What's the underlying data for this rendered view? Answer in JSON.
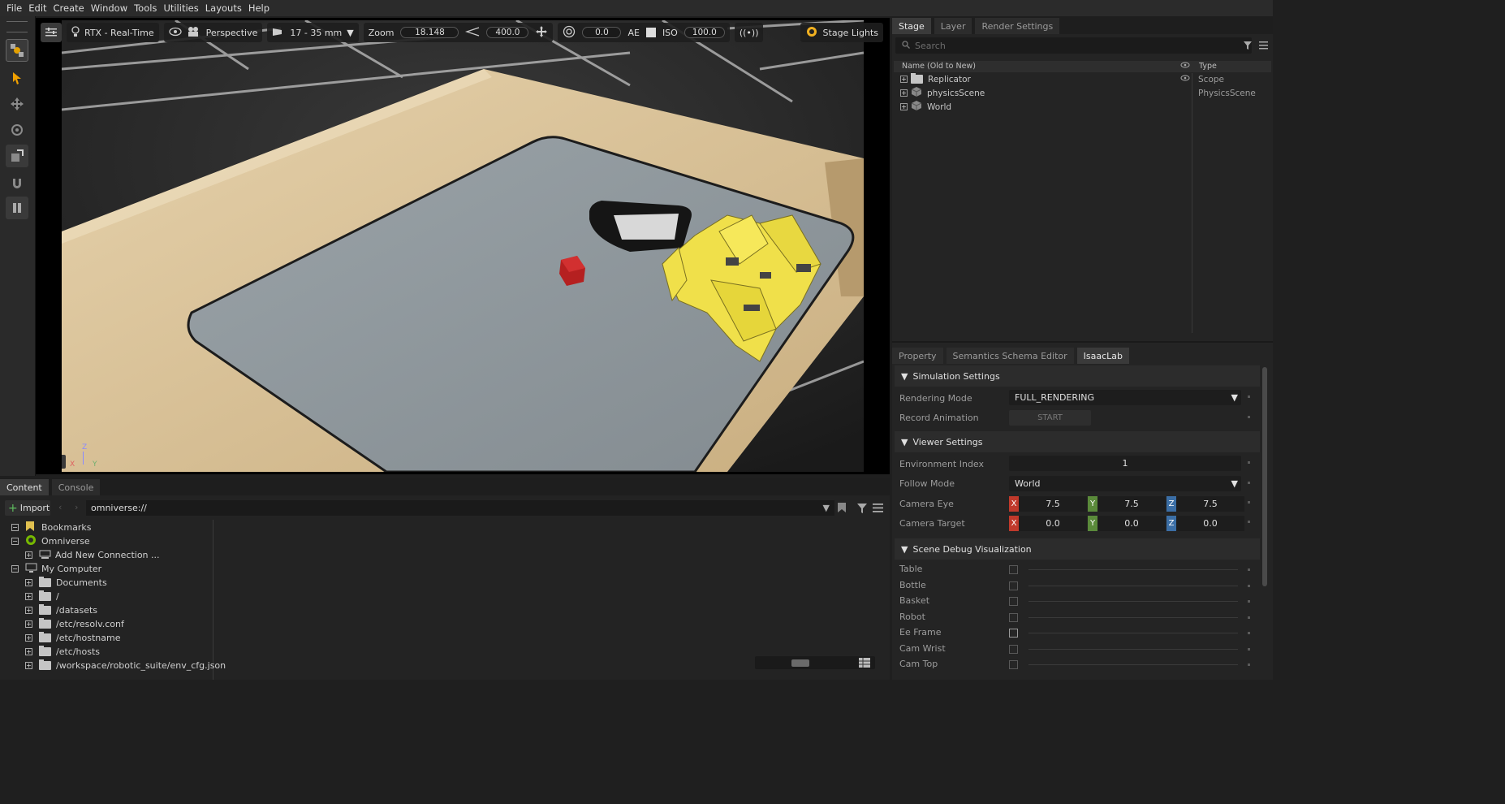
{
  "menu": [
    "File",
    "Edit",
    "Create",
    "Window",
    "Tools",
    "Utilities",
    "Layouts",
    "Help"
  ],
  "viewport": {
    "renderer": "RTX - Real-Time",
    "camera": "Perspective",
    "lens": "17 - 35 mm",
    "zoom_label": "Zoom",
    "zoom_value": "18.148",
    "fov_value": "400.0",
    "exposure_value": "0.0",
    "ae_label": "AE",
    "iso_label": "ISO",
    "iso_value": "100.0",
    "lights": "Stage Lights",
    "axis_x": "X",
    "axis_y": "Y",
    "axis_z": "Z",
    "units_badge": "m"
  },
  "stage": {
    "tabs": [
      "Stage",
      "Layer",
      "Render Settings"
    ],
    "search_placeholder": "Search",
    "col_name": "Name (Old to New)",
    "col_type": "Type",
    "rows": [
      {
        "name": "Replicator",
        "type": "Scope"
      },
      {
        "name": "physicsScene",
        "type": "PhysicsScene"
      },
      {
        "name": "World",
        "type": ""
      }
    ]
  },
  "props": {
    "tabs": [
      "Property",
      "Semantics Schema Editor",
      "IsaacLab"
    ],
    "sim_section": "Simulation Settings",
    "rendering_mode_label": "Rendering Mode",
    "rendering_mode_value": "FULL_RENDERING",
    "record_label": "Record Animation",
    "record_button": "START",
    "viewer_section": "Viewer Settings",
    "env_index_label": "Environment Index",
    "env_index_value": "1",
    "follow_label": "Follow Mode",
    "follow_value": "World",
    "cam_eye_label": "Camera Eye",
    "cam_eye": [
      "7.5",
      "7.5",
      "7.5"
    ],
    "cam_target_label": "Camera Target",
    "cam_target": [
      "0.0",
      "0.0",
      "0.0"
    ],
    "debug_section": "Scene Debug Visualization",
    "debug_items": [
      "Table",
      "Bottle",
      "Basket",
      "Robot",
      "Ee Frame",
      "Cam Wrist",
      "Cam Top"
    ]
  },
  "content": {
    "tabs": [
      "Content",
      "Console"
    ],
    "import_label": "Import",
    "path": "omniverse://",
    "tree": [
      {
        "label": "Bookmarks",
        "indent": 0,
        "exp": "−"
      },
      {
        "label": "Omniverse",
        "indent": 0,
        "exp": "−"
      },
      {
        "label": "Add New Connection ...",
        "indent": 1,
        "exp": "+"
      },
      {
        "label": "My Computer",
        "indent": 0,
        "exp": "−"
      },
      {
        "label": "Documents",
        "indent": 1,
        "exp": "+"
      },
      {
        "label": "/",
        "indent": 1,
        "exp": "+"
      },
      {
        "label": "/datasets",
        "indent": 1,
        "exp": "+"
      },
      {
        "label": "/etc/resolv.conf",
        "indent": 1,
        "exp": "+"
      },
      {
        "label": "/etc/hostname",
        "indent": 1,
        "exp": "+"
      },
      {
        "label": "/etc/hosts",
        "indent": 1,
        "exp": "+"
      },
      {
        "label": "/workspace/robotic_suite/env_cfg.json",
        "indent": 1,
        "exp": "+"
      }
    ]
  },
  "colors": {
    "axis_x": "#c0392b",
    "axis_y": "#5a8a3a",
    "axis_z": "#3b6ea5",
    "accent": "#f0b020"
  }
}
